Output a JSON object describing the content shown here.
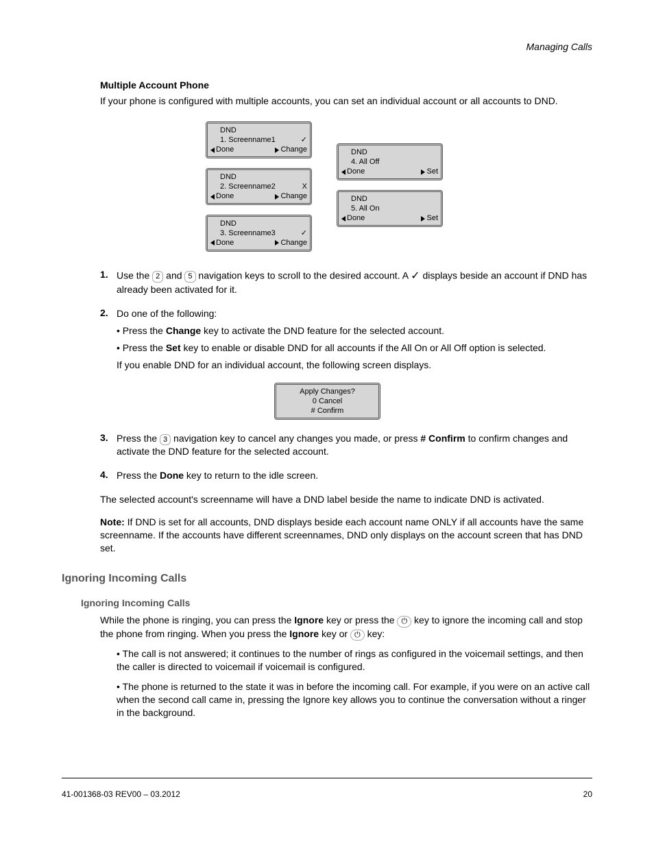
{
  "chapter_line": "Managing Calls",
  "section_title": "Multiple Account Phone",
  "intro_paragraph": "If your phone is configured with multiple accounts, you can set an individual account or all accounts to DND.",
  "screens": [
    {
      "title": "DND",
      "middle": "1.  Screenname1",
      "status": "✓",
      "left_soft": "Done",
      "right_soft": "Change"
    },
    {
      "title": "DND",
      "middle": "2.  Screenname2",
      "status": "X",
      "left_soft": "Done",
      "right_soft": "Change"
    },
    {
      "title": "DND",
      "middle": "3.  Screenname3",
      "status": "✓",
      "left_soft": "Done",
      "right_soft": "Change"
    }
  ],
  "screens_right": [
    {
      "title": "DND",
      "middle": "4.  All Off",
      "left_soft": "Done",
      "right_soft": "Set"
    },
    {
      "title": "DND",
      "middle": "5.  All On",
      "left_soft": "Done",
      "right_soft": "Set"
    }
  ],
  "step1": {
    "num": "1.",
    "line1_pre": "Use the ",
    "line1_mid1": "2",
    "line1_mid2": " and ",
    "line1_mid3": "5",
    "line1_mid4": " navigation keys to scroll to the desired account. A ",
    "line1_check": "✓",
    "line1_post": " displays beside an account if DND has already been activated for it.",
    "scroll_label_2": "2",
    "scroll_label_5": "5"
  },
  "step2": {
    "num": "2.",
    "line1": "Do one of the following:",
    "bullet1_pre": "• Press the ",
    "bullet1_bold": "Change",
    "bullet1_post": " key to activate the DND feature for the selected account.",
    "bullet2_pre": "• Press the ",
    "bullet2_bold": "Set",
    "bullet2_post": " key to enable or disable DND for all accounts if the All On or All Off option is selected.",
    "line2": "If you enable DND for an individual account, the following screen displays."
  },
  "apply_lcd": {
    "line1": "Apply Changes?",
    "line2": "0 Cancel",
    "line3": "# Confirm"
  },
  "step3": {
    "num": "3.",
    "line1_pre": "Press the 3 navigation key to cancel any changes you made, or press ",
    "line1_bold": "# Confirm",
    "line1_post": " to confirm changes and activate the DND feature for the selected account.",
    "key_3": "3"
  },
  "step4": {
    "num": "4.",
    "line1_pre": "Press the ",
    "line1_bold": "Done",
    "line1_post": " key to return to the idle screen."
  },
  "closing_para": "The selected account's screenname will have a DND label beside the name to indicate DND is activated.",
  "note_label": "Note: ",
  "note_body": "If DND is set for all accounts, DND displays beside each account name ONLY if all accounts have the same screenname. If the accounts have different screennames, DND only displays on the account screen that has DND set.",
  "h2": "Ignoring Incoming Calls",
  "h2_sub": "Ignoring Incoming Calls",
  "ring_para": {
    "p1_pre": "While the phone is ringing, you can press the ",
    "p1_bold1": "Ignore",
    "p1_mid1": " key or press the ",
    "p1_mid2": " key to ignore the incoming call and stop the phone from ringing. When you press the ",
    "p1_bold2": "Ignore",
    "p1_mid3": " key or ",
    "p1_mid4": " key:"
  },
  "ring_bullets": [
    "The call is not answered; it continues to the number of rings as configured in the voicemail settings, and then the caller is directed to voicemail if voicemail is configured.",
    "The phone is returned to the state it was in before the incoming call. For example, if you were on an active call when the second call came in, pressing the Ignore key allows you to continue the conversation without a ringer in the background."
  ],
  "footer": {
    "left": "41-001368-03 REV00 – 03.2012",
    "right": "20"
  },
  "icons": {
    "goodbye": "⏻"
  }
}
